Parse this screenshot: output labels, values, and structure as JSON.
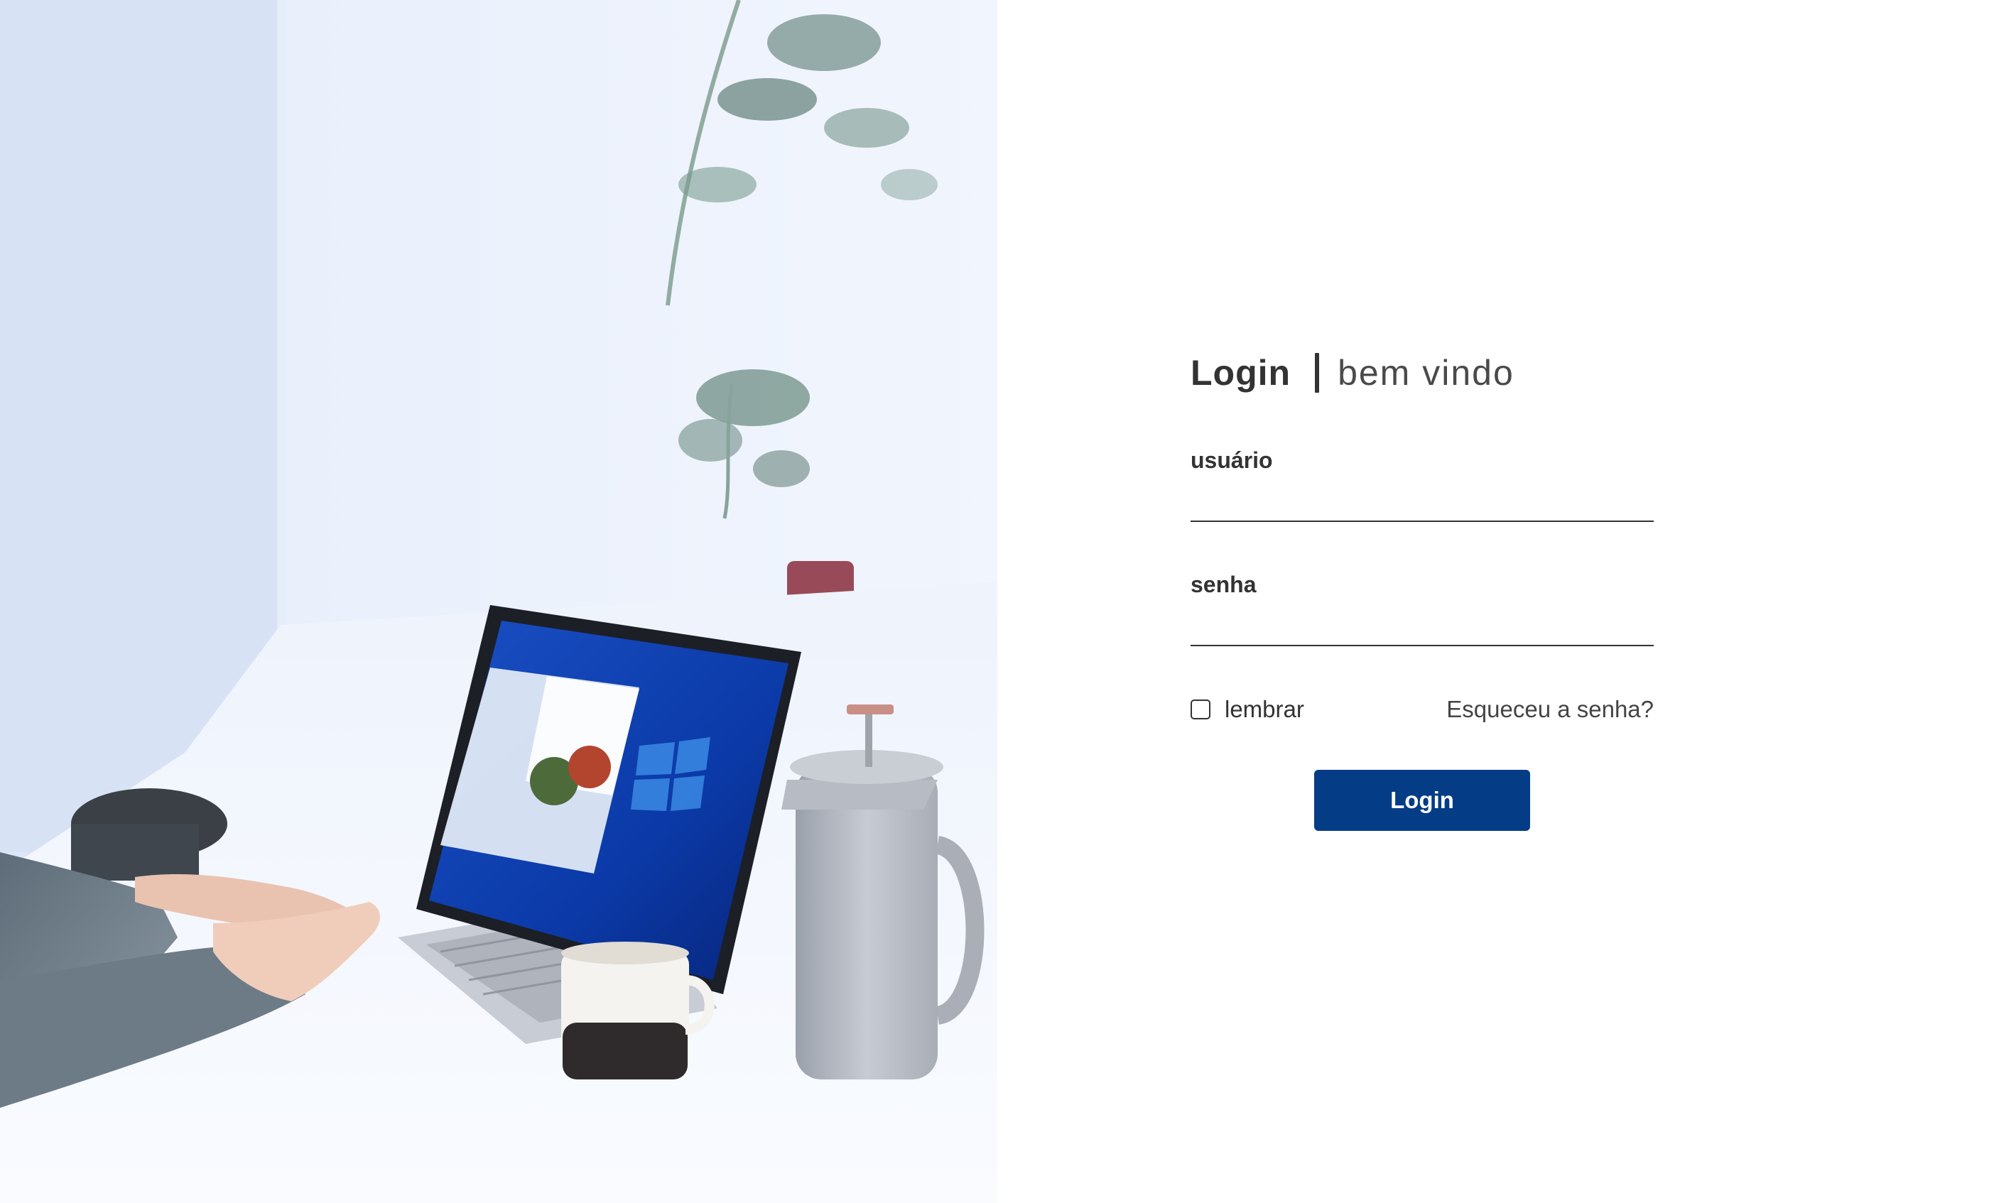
{
  "login": {
    "title": "Login",
    "subtitle": "bem vindo",
    "fields": {
      "username": {
        "label": "usuário",
        "value": "",
        "placeholder": ""
      },
      "password": {
        "label": "senha",
        "value": "",
        "placeholder": ""
      }
    },
    "remember_label": "lembrar",
    "remember_checked": false,
    "forgot_link": "Esqueceu a senha?",
    "submit_label": "Login"
  },
  "photo": {
    "subject": "person-typing-on-laptop-photo"
  },
  "colors": {
    "accent": "#043c86",
    "text": "#333333",
    "background": "#ffffff",
    "photo_tint": "#e6eefb"
  }
}
